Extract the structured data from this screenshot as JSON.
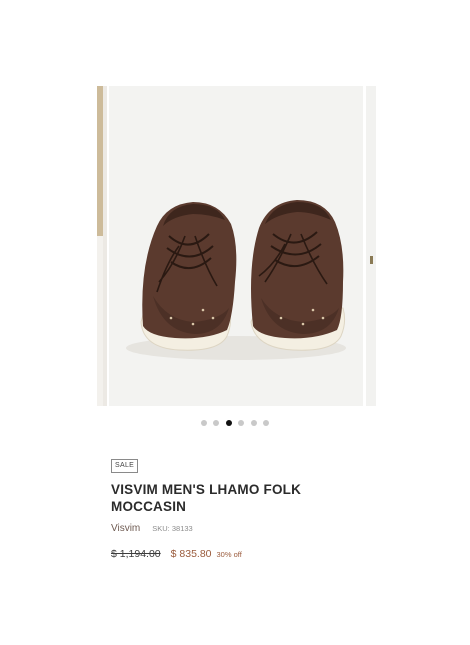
{
  "gallery": {
    "image_alt": "Brown suede moccasin sneakers with white soles",
    "dot_count": 6,
    "active_index": 2
  },
  "product": {
    "badge": "SALE",
    "title": "VISVIM MEN'S LHAMO FOLK MOCCASIN",
    "vendor": "Visvim",
    "sku": "SKU: 38133",
    "price_compare": "$ 1,194.00",
    "price_current": "$ 835.80",
    "discount": "30% off"
  },
  "colors": {
    "sale_price": "#9a5b3c",
    "vendor": "#6f5b52",
    "active_dot": "#111111",
    "inactive_dot": "#c9c9c9"
  }
}
